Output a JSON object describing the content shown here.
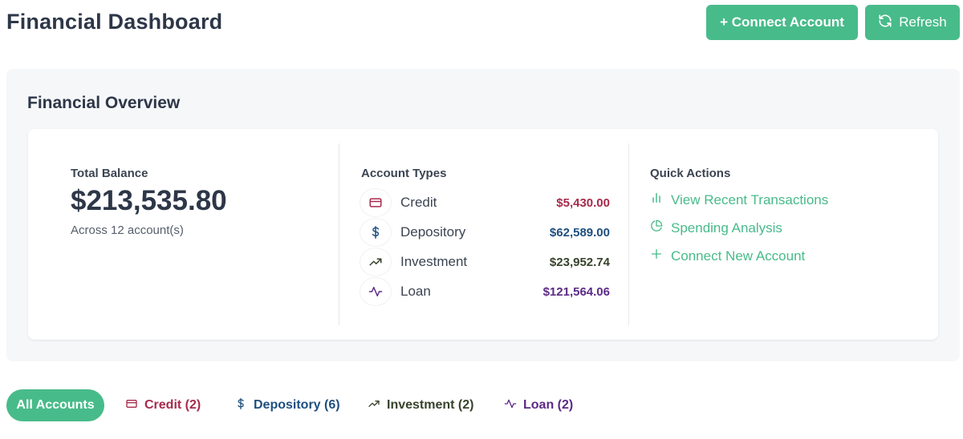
{
  "header": {
    "title": "Financial Dashboard",
    "connect_label": "+ Connect Account",
    "refresh_label": "Refresh"
  },
  "overview": {
    "title": "Financial Overview",
    "total_balance": {
      "label": "Total Balance",
      "value": "$213,535.80",
      "subtitle": "Across 12 account(s)"
    },
    "account_types": {
      "label": "Account Types",
      "items": [
        {
          "name": "Credit",
          "amount": "$5,430.00",
          "color": "#a72a4b",
          "icon": "credit-card-icon"
        },
        {
          "name": "Depository",
          "amount": "$62,589.00",
          "color": "#1f4f7f",
          "icon": "dollar-icon"
        },
        {
          "name": "Investment",
          "amount": "$23,952.74",
          "color": "#37432b",
          "icon": "trending-up-icon"
        },
        {
          "name": "Loan",
          "amount": "$121,564.06",
          "color": "#5b2b86",
          "icon": "activity-icon"
        }
      ]
    },
    "quick_actions": {
      "label": "Quick Actions",
      "items": [
        {
          "label": "View Recent Transactions",
          "icon": "bar-chart-icon"
        },
        {
          "label": "Spending Analysis",
          "icon": "pie-chart-icon"
        },
        {
          "label": "Connect New Account",
          "icon": "plus-icon"
        }
      ]
    }
  },
  "filters": {
    "all": "All Accounts",
    "credit": "Credit (2)",
    "depository": "Depository (6)",
    "investment": "Investment (2)",
    "loan": "Loan (2)"
  },
  "colors": {
    "accent": "#48bb8a",
    "credit": "#a72a4b",
    "depository": "#1f4f7f",
    "investment": "#37432b",
    "loan": "#5b2b86"
  }
}
